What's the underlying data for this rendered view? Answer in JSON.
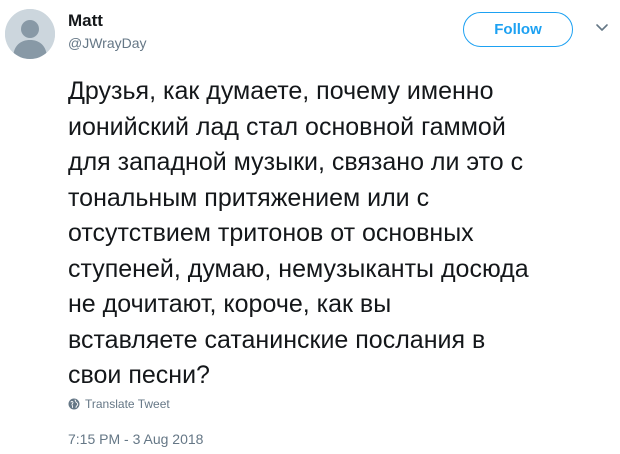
{
  "author": {
    "name": "Matt",
    "handle": "@JWrayDay"
  },
  "follow_button": {
    "label": "Follow"
  },
  "menu": {
    "icon": "chevron-down-icon"
  },
  "tweet": {
    "text": "Друзья, как думаете, почему именно\nионийский лад стал основной гаммой\nдля западной музыки, связано ли это с\nтональным притяжением или с\nотсутствием тритонов от основных\nступеней, думаю, немузыканты досюда\nне дочитают, короче, как вы\nвставляете сатанинские послания в\nсвои песни?",
    "translate_label": "Translate Tweet",
    "timestamp": "7:15 PM - 3 Aug 2018"
  },
  "colors": {
    "accent": "#1da1f2",
    "secondary_text": "#657786",
    "primary_text": "#14171a",
    "avatar_bg": "#ccd6dd"
  }
}
